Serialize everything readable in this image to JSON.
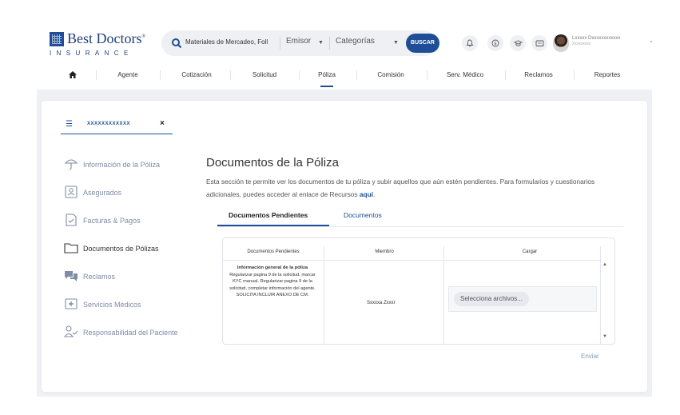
{
  "brand": {
    "name": "Best Doctors",
    "reg": "®",
    "sub": "INSURANCE"
  },
  "search": {
    "value": "Materiales de Mercadeo, Foll",
    "filter1": "Emisor",
    "filter2": "Categorías",
    "button": "BUSCAR"
  },
  "user": {
    "name": "Lxxxxx Dxxxxxxxxxxxx",
    "role": "Xxxxxxxxx"
  },
  "nav": [
    "Agente",
    "Cotización",
    "Solicitud",
    "Póliza",
    "Comisión",
    "Serv. Médico",
    "Reclamos",
    "Reportes"
  ],
  "policy_tab": {
    "number": "XXXXXXXXXXXX"
  },
  "sidebar": [
    {
      "label": "Información de la Póliza",
      "icon": "umbrella-icon"
    },
    {
      "label": "Asegurados",
      "icon": "id-card-icon"
    },
    {
      "label": "Facturas & Pagos",
      "icon": "invoice-icon"
    },
    {
      "label": "Documentos de Pólizas",
      "icon": "folder-icon"
    },
    {
      "label": "Reclamos",
      "icon": "chat-icon"
    },
    {
      "label": "Servicios Médicos",
      "icon": "medical-icon"
    },
    {
      "label": "Responsabilidad del Paciente",
      "icon": "user-check-icon"
    }
  ],
  "main": {
    "title": "Documentos de la Póliza",
    "desc": "Esta sección te permite ver los documentos de tu póliza y subir aquellos que aún estén pendientes. Para formularios y cuestionarios adicionales, puedes acceder al enlace de Recursos",
    "desc_link": "aquí",
    "tabs": [
      "Documentos Pendientes",
      "Documentos"
    ]
  },
  "table": {
    "headers": [
      "Documentos Pendientes",
      "Miembro",
      "Cargar"
    ],
    "row": {
      "doc_title": "Información general de la póliza",
      "doc_detail": "Regularizar pagina 9 de la solicitud, marcar KYC manual. Regularizar pagina 9 de la solicitud, completar información del agente. SOLICITA INCLUIR ANEXO DE CM.",
      "member": "Sxxxxa Zxxxr",
      "upload_label": "Selecciona archivos..."
    }
  },
  "submit": "Enviar",
  "colors": {
    "primary": "#1f4e96",
    "stage": "#eef0f3",
    "sidebar_text": "#7e8ca5"
  }
}
